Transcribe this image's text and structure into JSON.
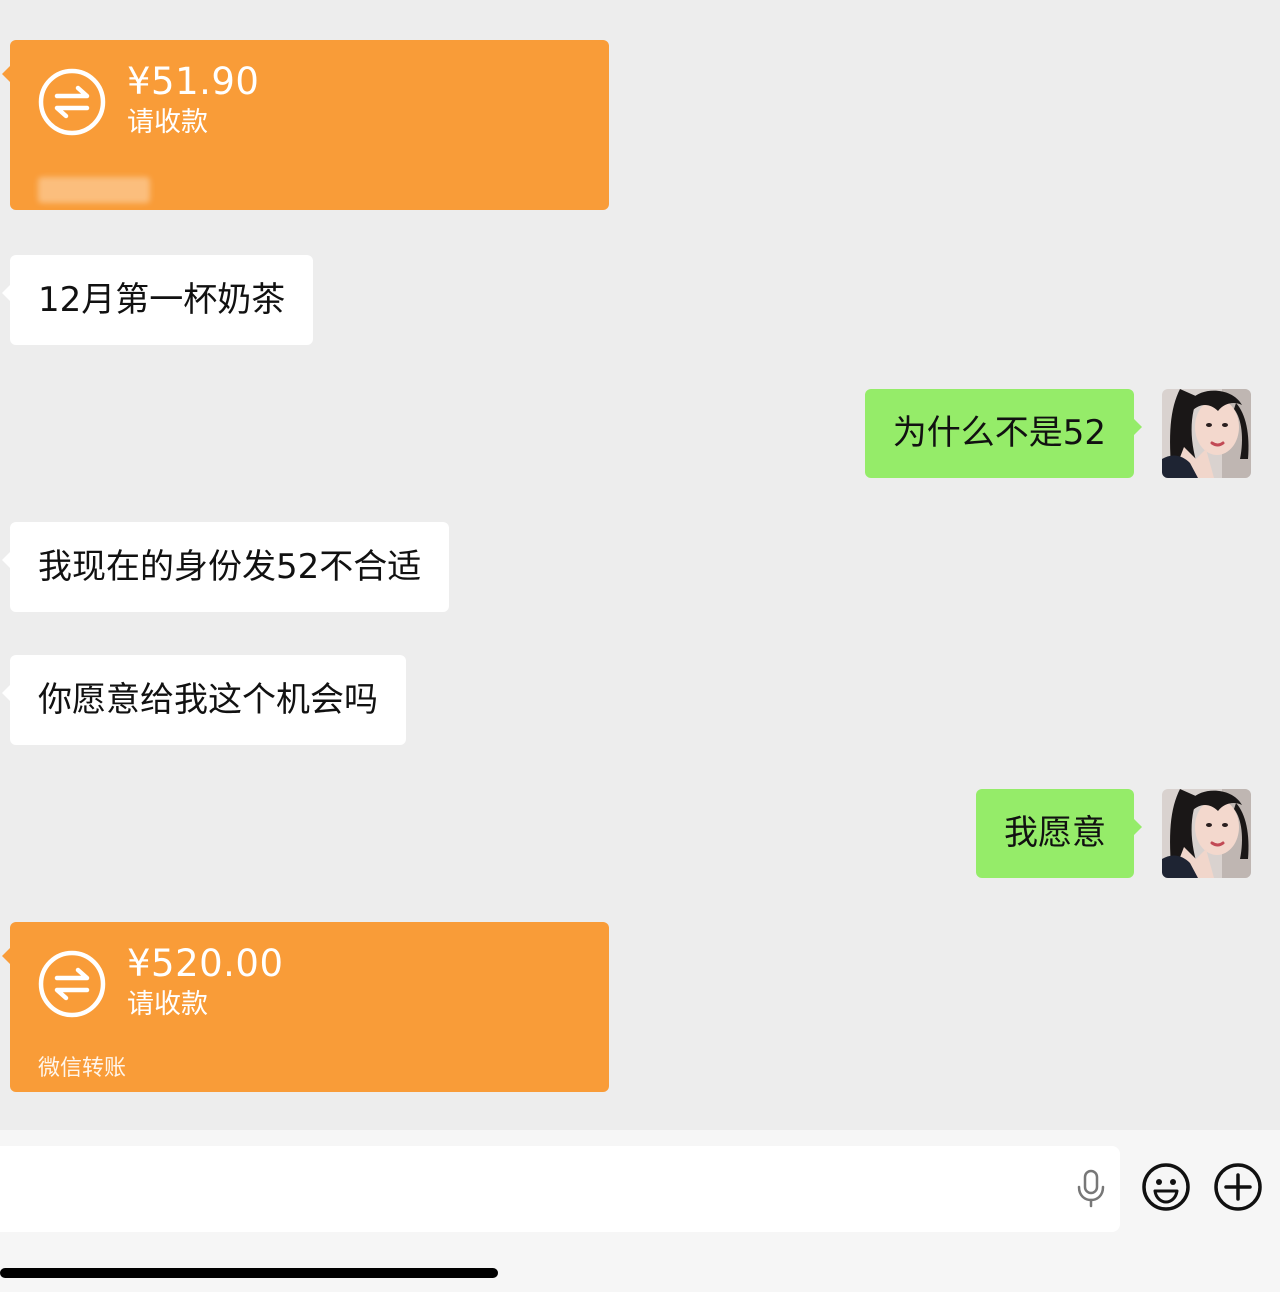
{
  "colors": {
    "background": "#ededed",
    "transfer_card": "#f99c38",
    "incoming_bubble": "#ffffff",
    "outgoing_bubble": "#95ec69"
  },
  "messages": {
    "transfer_1": {
      "amount": "¥51.90",
      "status": "请收款",
      "icon": "transfer-arrows-icon"
    },
    "incoming_1": {
      "text": "12月第一杯奶茶"
    },
    "outgoing_1": {
      "text": "为什么不是52"
    },
    "incoming_2": {
      "text": "我现在的身份发52不合适"
    },
    "incoming_3": {
      "text": "你愿意给我这个机会吗"
    },
    "outgoing_2": {
      "text": "我愿意"
    },
    "transfer_2": {
      "amount": "¥520.00",
      "status": "请收款",
      "source": "微信转账",
      "icon": "transfer-arrows-icon"
    }
  },
  "input_bar": {
    "icons": [
      "microphone-icon",
      "emoji-icon",
      "plus-circle-icon"
    ]
  }
}
